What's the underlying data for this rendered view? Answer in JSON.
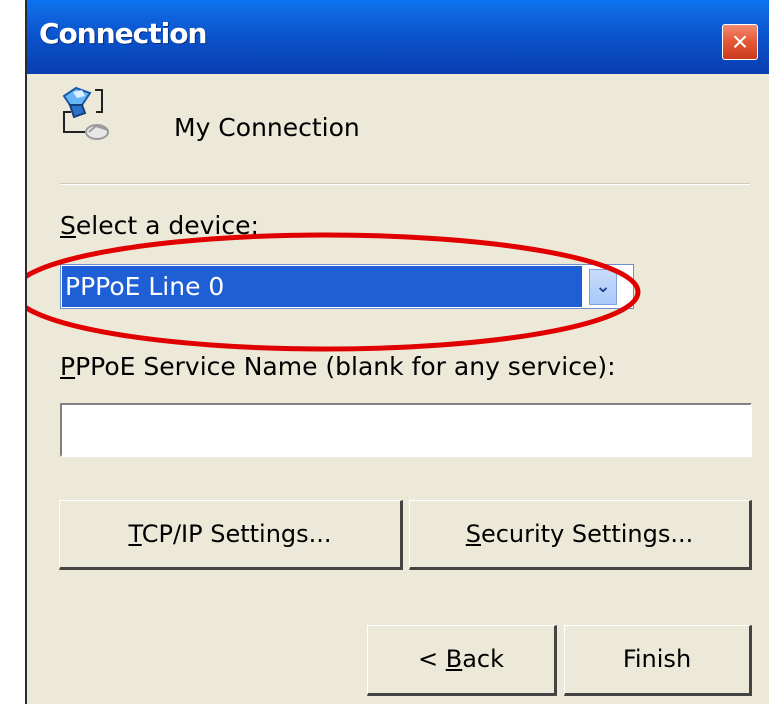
{
  "window": {
    "title": "Connection",
    "close_label": "×"
  },
  "header": {
    "connection_name": "My Connection"
  },
  "form": {
    "select_device_label_prefix": "",
    "select_device_accesskey": "S",
    "select_device_label_suffix": "elect a device:",
    "selected_device": "PPPoE Line 0",
    "dropdown_icon": "⌄",
    "service_label_prefix": "",
    "service_label_accesskey": "P",
    "service_label_suffix": "PPoE Service Name (blank for any service):",
    "service_name_value": ""
  },
  "buttons": {
    "tcp_prefix": "",
    "tcp_accesskey": "T",
    "tcp_suffix": "CP/IP Settings...",
    "security_prefix": "",
    "security_accesskey": "S",
    "security_suffix": "ecurity Settings...",
    "back_prefix": "< ",
    "back_accesskey": "B",
    "back_suffix": "ack",
    "finish": "Finish"
  },
  "icons": {
    "connection": "network-connection-icon",
    "dropdown": "chevron-down-icon",
    "close": "close-icon",
    "highlight": "red-oval-highlight"
  },
  "colors": {
    "title_bar": "#0a50c9",
    "selection": "#1f5fd6",
    "highlight": "#e00000",
    "dialog_background": "#ece9d8"
  }
}
